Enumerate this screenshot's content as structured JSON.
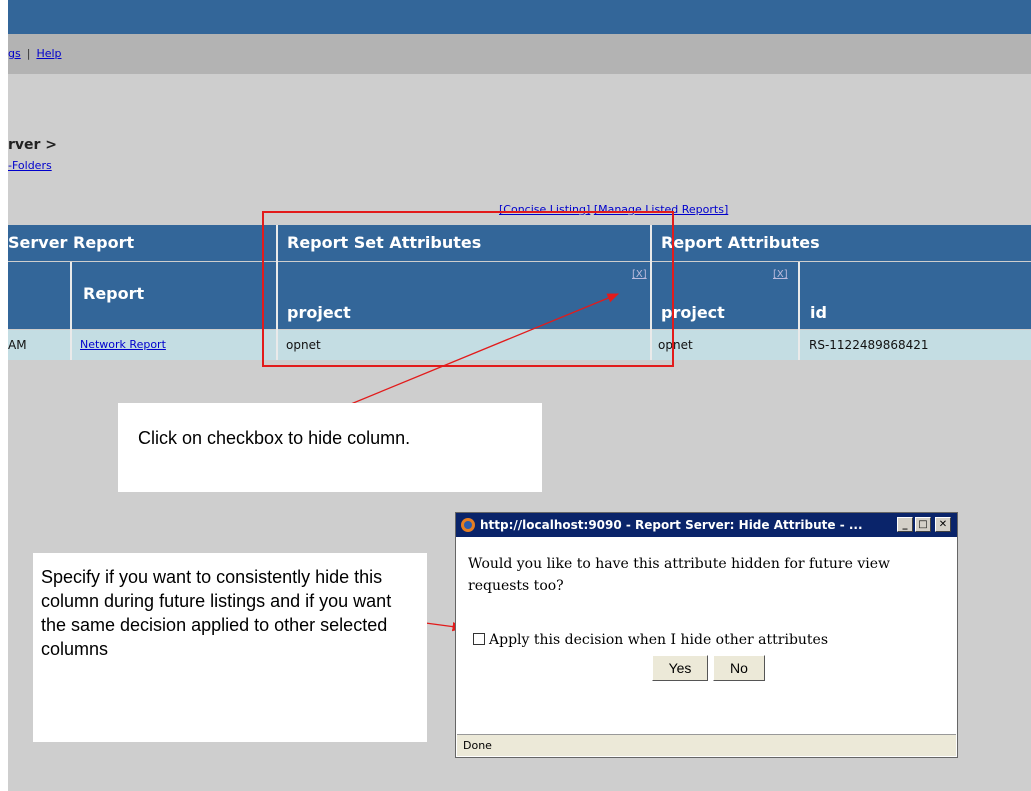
{
  "nav": {
    "link1": "gs",
    "sep": "|",
    "link2": "Help"
  },
  "breadcrumb": {
    "title": "rver >",
    "sublink": "-Folders"
  },
  "listing_links": {
    "concise": "[Concise Listing]",
    "manage": "[Manage Listed Reports]"
  },
  "table": {
    "group_headers": [
      "Server Report",
      "Report Set Attributes",
      "Report Attributes"
    ],
    "hide_marker": "[X]",
    "columns": [
      "",
      "Report",
      "project",
      "project",
      "id"
    ],
    "row": [
      "AM",
      "Network Report",
      "opnet",
      "opnet",
      "RS-1122489868421"
    ]
  },
  "callouts": {
    "hide_column": "Click on checkbox to hide column.",
    "future": "Specify if you want to consistently hide this column during future listings and if you want the same decision applied to other selected columns"
  },
  "dialog": {
    "title": "http://localhost:9090 - Report Server: Hide Attribute - ...",
    "question": "Would you like to have this attribute hidden for future view requests too?",
    "checkbox_label": "Apply this decision when I hide other attributes",
    "checkbox_checked": false,
    "yes": "Yes",
    "no": "No",
    "status": "Done"
  },
  "colors": {
    "header": "#336699",
    "row": "#c4dde3",
    "annotation": "#e21b1b",
    "dialog_title": "#0a246a"
  }
}
